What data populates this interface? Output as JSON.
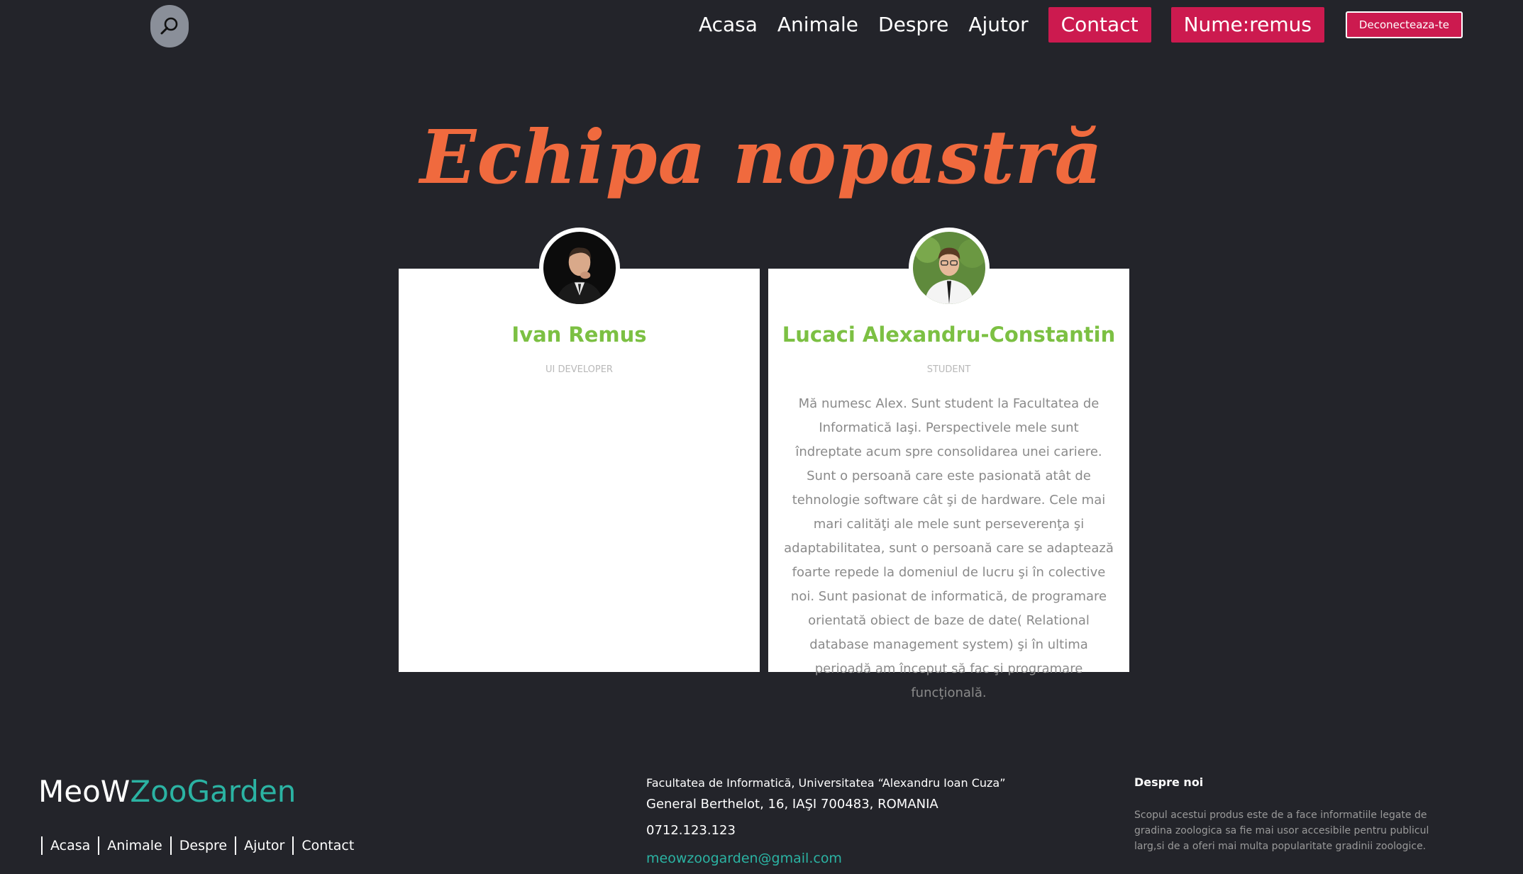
{
  "header": {
    "search_icon": "search-icon",
    "nav": {
      "home": "Acasa",
      "animals": "Animale",
      "about": "Despre",
      "help": "Ajutor",
      "contact": "Contact",
      "username": "Nume:remus",
      "logout": "Deconecteaza-te"
    }
  },
  "colors": {
    "background": "#23242a",
    "accent_pink": "#cc1a4f",
    "title_orange": "#f06a3e",
    "name_green": "#7cc043",
    "teal": "#2bb3a3"
  },
  "team": {
    "title": "Echipa nopastră",
    "members": [
      {
        "name": "Ivan Remus",
        "role": "UI DEVELOPER",
        "description": ""
      },
      {
        "name": "Lucaci Alexandru-Constantin",
        "role": "STUDENT",
        "description": "Mă numesc Alex. Sunt student la Facultatea de Informatică Iaşi. Perspectivele mele sunt îndreptate acum spre consolidarea unei cariere. Sunt o persoană care este pasionată atât de tehnologie software cât şi de hardware. Cele mai mari calităţi ale mele sunt perseverenţa şi adaptabilitatea, sunt o persoană care se adaptează foarte repede la domeniul de lucru şi în colective noi. Sunt pasionat de informatică, de programare orientată obiect de baze de date( Relational database management system) şi în ultima perioadă am început să fac şi programare funcţională."
      }
    ]
  },
  "footer": {
    "logo_part1": "MeoW",
    "logo_part2": "ZooGarden",
    "links": [
      "Acasa",
      "Animale",
      "Despre",
      "Ajutor",
      "Contact"
    ],
    "contact": {
      "faculty": "Facultatea de Informatică, Universitatea “Alexandru Ioan Cuza”",
      "address": "General Berthelot, 16, IAŞI 700483, ROMANIA",
      "phone": "0712.123.123",
      "email": "meowzoogarden@gmail.com"
    },
    "about": {
      "title": "Despre noi",
      "text": "Scopul acestui produs este de a face informatiile legate de gradina zoologica sa fie mai usor accesibile pentru publicul larg,si de a oferi mai multa popularitate gradinii zoologice."
    }
  }
}
